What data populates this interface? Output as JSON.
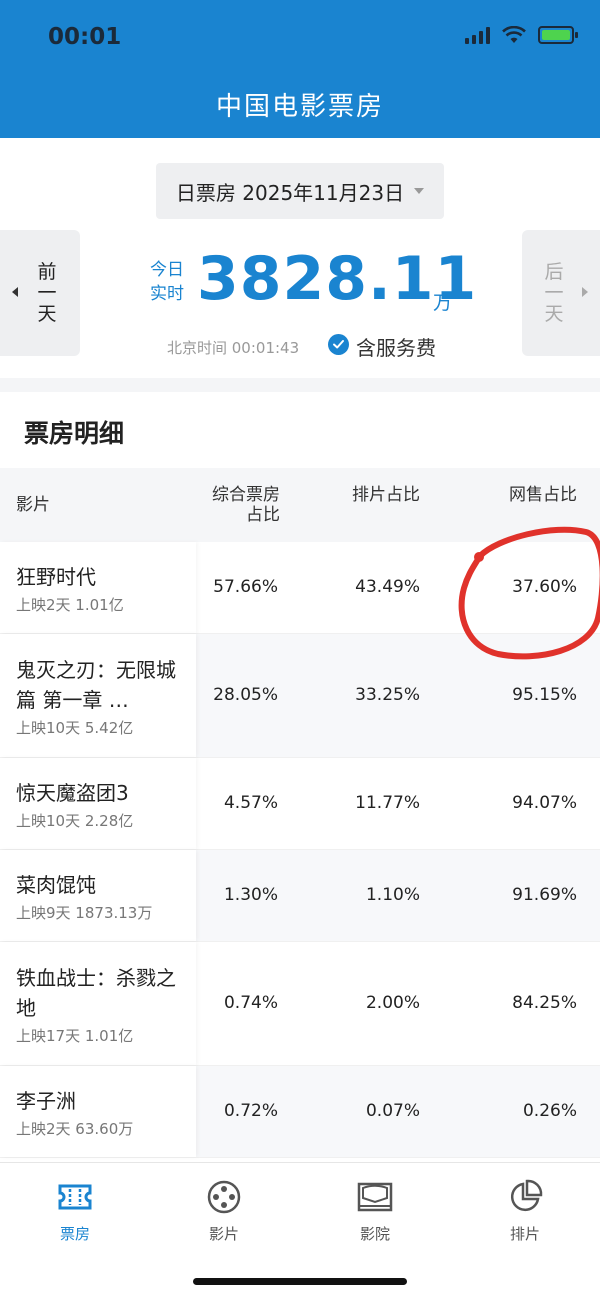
{
  "status_bar": {
    "time": "00:01"
  },
  "header": {
    "title": "中国电影票房"
  },
  "summary": {
    "date_selector": "日票房 2025年11月23日",
    "prev_day": "前一天",
    "next_day": "后一天",
    "today_label": "今日实时",
    "total": "3828.11",
    "unit": "万",
    "beijing_time": "北京时间 00:01:43",
    "service_fee": "含服务费"
  },
  "detail": {
    "title": "票房明细",
    "columns": [
      "影片",
      "综合票房占比",
      "排片占比",
      "网售占比"
    ],
    "rows": [
      {
        "name": "狂野时代",
        "info": "上映2天 1.01亿",
        "box_share": "57.66%",
        "schedule_share": "43.49%",
        "online_share": "37.60%"
      },
      {
        "name": "鬼灭之刃：无限城篇 第一章 …",
        "info": "上映10天 5.42亿",
        "box_share": "28.05%",
        "schedule_share": "33.25%",
        "online_share": "95.15%"
      },
      {
        "name": "惊天魔盗团3",
        "info": "上映10天 2.28亿",
        "box_share": "4.57%",
        "schedule_share": "11.77%",
        "online_share": "94.07%"
      },
      {
        "name": "菜肉馄饨",
        "info": "上映9天 1873.13万",
        "box_share": "1.30%",
        "schedule_share": "1.10%",
        "online_share": "91.69%"
      },
      {
        "name": "铁血战士：杀戮之地",
        "info": "上映17天 1.01亿",
        "box_share": "0.74%",
        "schedule_share": "2.00%",
        "online_share": "84.25%"
      },
      {
        "name": "李子洲",
        "info": "上映2天 63.60万",
        "box_share": "0.72%",
        "schedule_share": "0.07%",
        "online_share": "0.26%"
      }
    ]
  },
  "tabbar": {
    "tabs": [
      {
        "label": "票房",
        "icon": "ticket-icon"
      },
      {
        "label": "影片",
        "icon": "film-reel-icon"
      },
      {
        "label": "影院",
        "icon": "cinema-screen-icon"
      },
      {
        "label": "排片",
        "icon": "pie-chart-icon"
      }
    ]
  },
  "colors": {
    "brand": "#1a84d0",
    "annotation": "#e0322b"
  }
}
